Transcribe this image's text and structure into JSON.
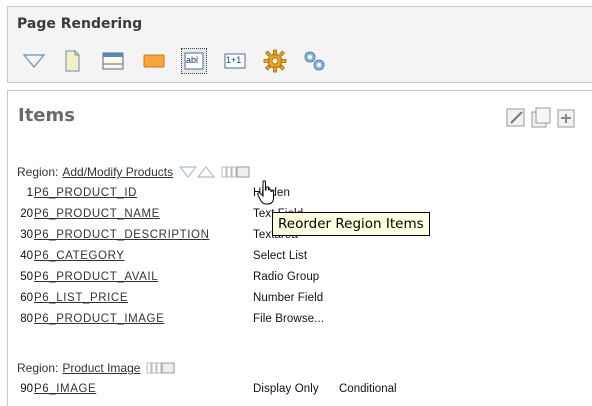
{
  "page_rendering": {
    "title": "Page Rendering",
    "toolbar": [
      {
        "name": "collapse-triangle-icon"
      },
      {
        "name": "page-icon"
      },
      {
        "name": "region-icon"
      },
      {
        "name": "button-icon"
      },
      {
        "name": "item-icon",
        "label": "abl",
        "selected": true
      },
      {
        "name": "computation-icon",
        "label": "1+1"
      },
      {
        "name": "process-gear-icon"
      },
      {
        "name": "shared-components-gears-icon"
      }
    ]
  },
  "items": {
    "title": "Items",
    "regions": [
      {
        "label": "Region:",
        "name": "Add/Modify Products",
        "rows": [
          {
            "seq": "1",
            "name": "P6_PRODUCT_ID",
            "type": "Hidden"
          },
          {
            "seq": "20",
            "name": "P6_PRODUCT_NAME",
            "type": "Text Field"
          },
          {
            "seq": "30",
            "name": "P6_PRODUCT_DESCRIPTION",
            "type": "Textarea"
          },
          {
            "seq": "40",
            "name": "P6_CATEGORY",
            "type": "Select List"
          },
          {
            "seq": "50",
            "name": "P6_PRODUCT_AVAIL",
            "type": "Radio Group"
          },
          {
            "seq": "60",
            "name": "P6_LIST_PRICE",
            "type": "Number Field"
          },
          {
            "seq": "80",
            "name": "P6_PRODUCT_IMAGE",
            "type": "File Browse..."
          }
        ]
      },
      {
        "label": "Region:",
        "name": "Product Image",
        "rows": [
          {
            "seq": "90",
            "name": "P6_IMAGE",
            "type": "Display Only",
            "condition": "Conditional"
          }
        ]
      }
    ]
  },
  "tooltip": {
    "text": "Reorder Region Items"
  }
}
